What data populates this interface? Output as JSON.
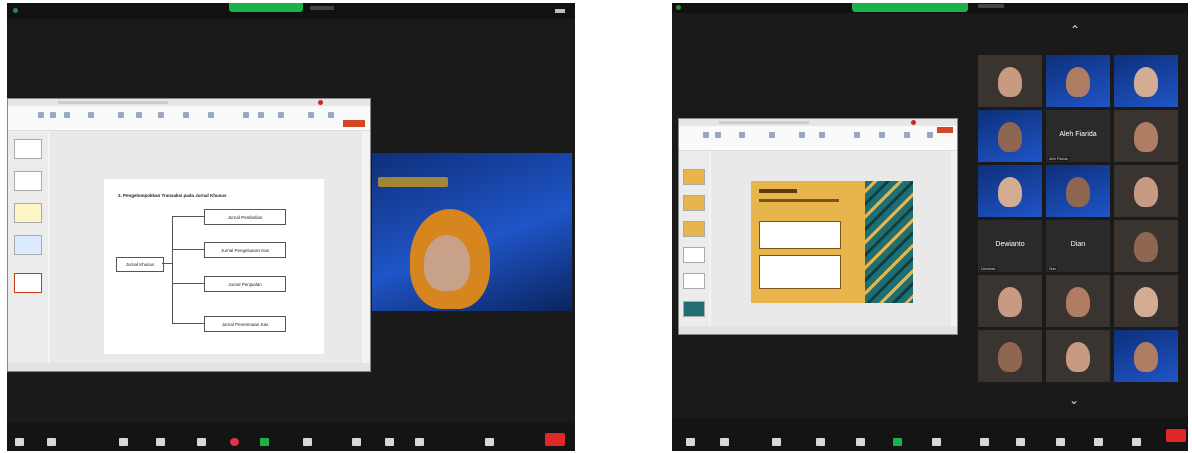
{
  "left": {
    "slide": {
      "title": "3. Pengelompokkan Transaksi pada Jurnal Khusus",
      "root_box": "Jurnal Khusus",
      "branches": [
        "Jurnal Pembelian",
        "Jurnal Pengeluaran Kas",
        "Jurnal Penjualan",
        "Jurnal Penerimaan Kas"
      ]
    }
  },
  "right": {
    "tiles": [
      {
        "name": "",
        "text": "",
        "kind": "photo"
      },
      {
        "name": "",
        "text": "",
        "kind": "photo-blue"
      },
      {
        "name": "",
        "text": "",
        "kind": "photo-blue"
      },
      {
        "name": "",
        "text": "",
        "kind": "photo-blue"
      },
      {
        "name": "Aleh Fiarida",
        "text": "Aleh Fiarida",
        "kind": "name"
      },
      {
        "name": "",
        "text": "",
        "kind": "photo"
      },
      {
        "name": "",
        "text": "",
        "kind": "photo-blue"
      },
      {
        "name": "",
        "text": "",
        "kind": "photo-blue"
      },
      {
        "name": "",
        "text": "",
        "kind": "photo"
      },
      {
        "name": "Dewianto",
        "text": "Dewianto",
        "kind": "name"
      },
      {
        "name": "Dian",
        "text": "Dian",
        "kind": "name"
      },
      {
        "name": "",
        "text": "",
        "kind": "photo"
      },
      {
        "name": "",
        "text": "",
        "kind": "photo"
      },
      {
        "name": "",
        "text": "",
        "kind": "photo"
      },
      {
        "name": "",
        "text": "",
        "kind": "photo"
      },
      {
        "name": "",
        "text": "",
        "kind": "photo"
      },
      {
        "name": "",
        "text": "",
        "kind": "photo"
      },
      {
        "name": "",
        "text": "",
        "kind": "photo-blue"
      }
    ]
  },
  "colors": {
    "zoom_bg": "#1a1a1a",
    "share_green": "#1cb24b",
    "end_red": "#e02828",
    "slide_mustard": "#e8b54c",
    "slide_teal": "#1f6e72",
    "blue_tile": "#1f55c7"
  },
  "icons": [
    "mic-icon",
    "video-icon",
    "security-icon",
    "participants-icon",
    "chat-icon",
    "react-icon",
    "share-screen-icon",
    "record-icon",
    "apps-icon",
    "more-icon"
  ]
}
